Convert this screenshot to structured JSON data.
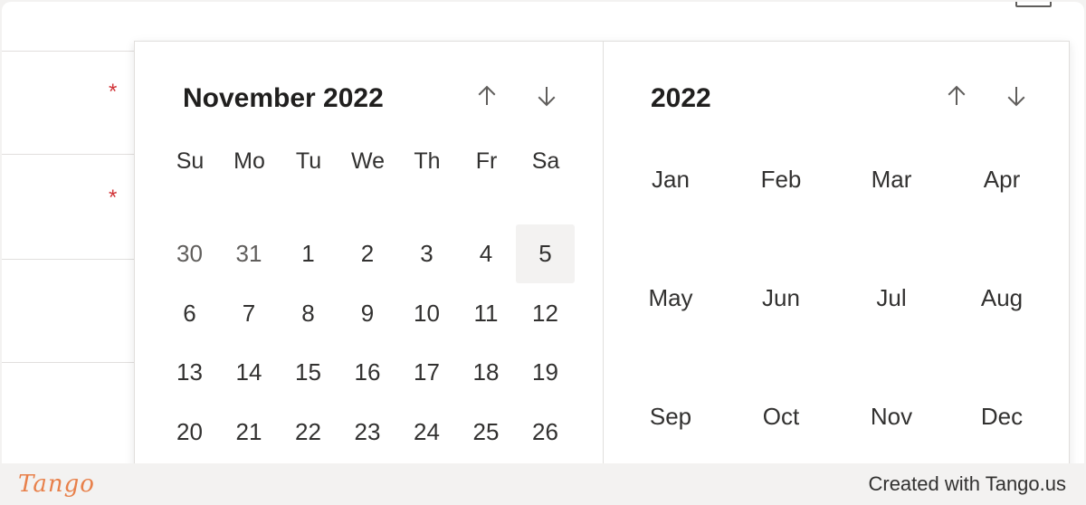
{
  "form": {
    "required_marker": "*"
  },
  "calendar": {
    "month_title": "November 2022",
    "year_title": "2022",
    "weekdays": [
      "Su",
      "Mo",
      "Tu",
      "We",
      "Th",
      "Fr",
      "Sa"
    ],
    "weeks": [
      [
        {
          "label": "30",
          "other": true
        },
        {
          "label": "31",
          "other": true
        },
        {
          "label": "1"
        },
        {
          "label": "2"
        },
        {
          "label": "3"
        },
        {
          "label": "4"
        },
        {
          "label": "5",
          "today": true
        }
      ],
      [
        {
          "label": "6"
        },
        {
          "label": "7"
        },
        {
          "label": "8"
        },
        {
          "label": "9"
        },
        {
          "label": "10"
        },
        {
          "label": "11"
        },
        {
          "label": "12"
        }
      ],
      [
        {
          "label": "13"
        },
        {
          "label": "14"
        },
        {
          "label": "15"
        },
        {
          "label": "16"
        },
        {
          "label": "17"
        },
        {
          "label": "18"
        },
        {
          "label": "19"
        }
      ],
      [
        {
          "label": "20"
        },
        {
          "label": "21"
        },
        {
          "label": "22"
        },
        {
          "label": "23"
        },
        {
          "label": "24"
        },
        {
          "label": "25"
        },
        {
          "label": "26"
        }
      ]
    ],
    "months": [
      "Jan",
      "Feb",
      "Mar",
      "Apr",
      "May",
      "Jun",
      "Jul",
      "Aug",
      "Sep",
      "Oct",
      "Nov",
      "Dec"
    ],
    "icons": {
      "prev": "arrow-up-icon",
      "next": "arrow-down-icon"
    }
  },
  "footer": {
    "brand": "Tango",
    "credit": "Created with Tango.us"
  }
}
